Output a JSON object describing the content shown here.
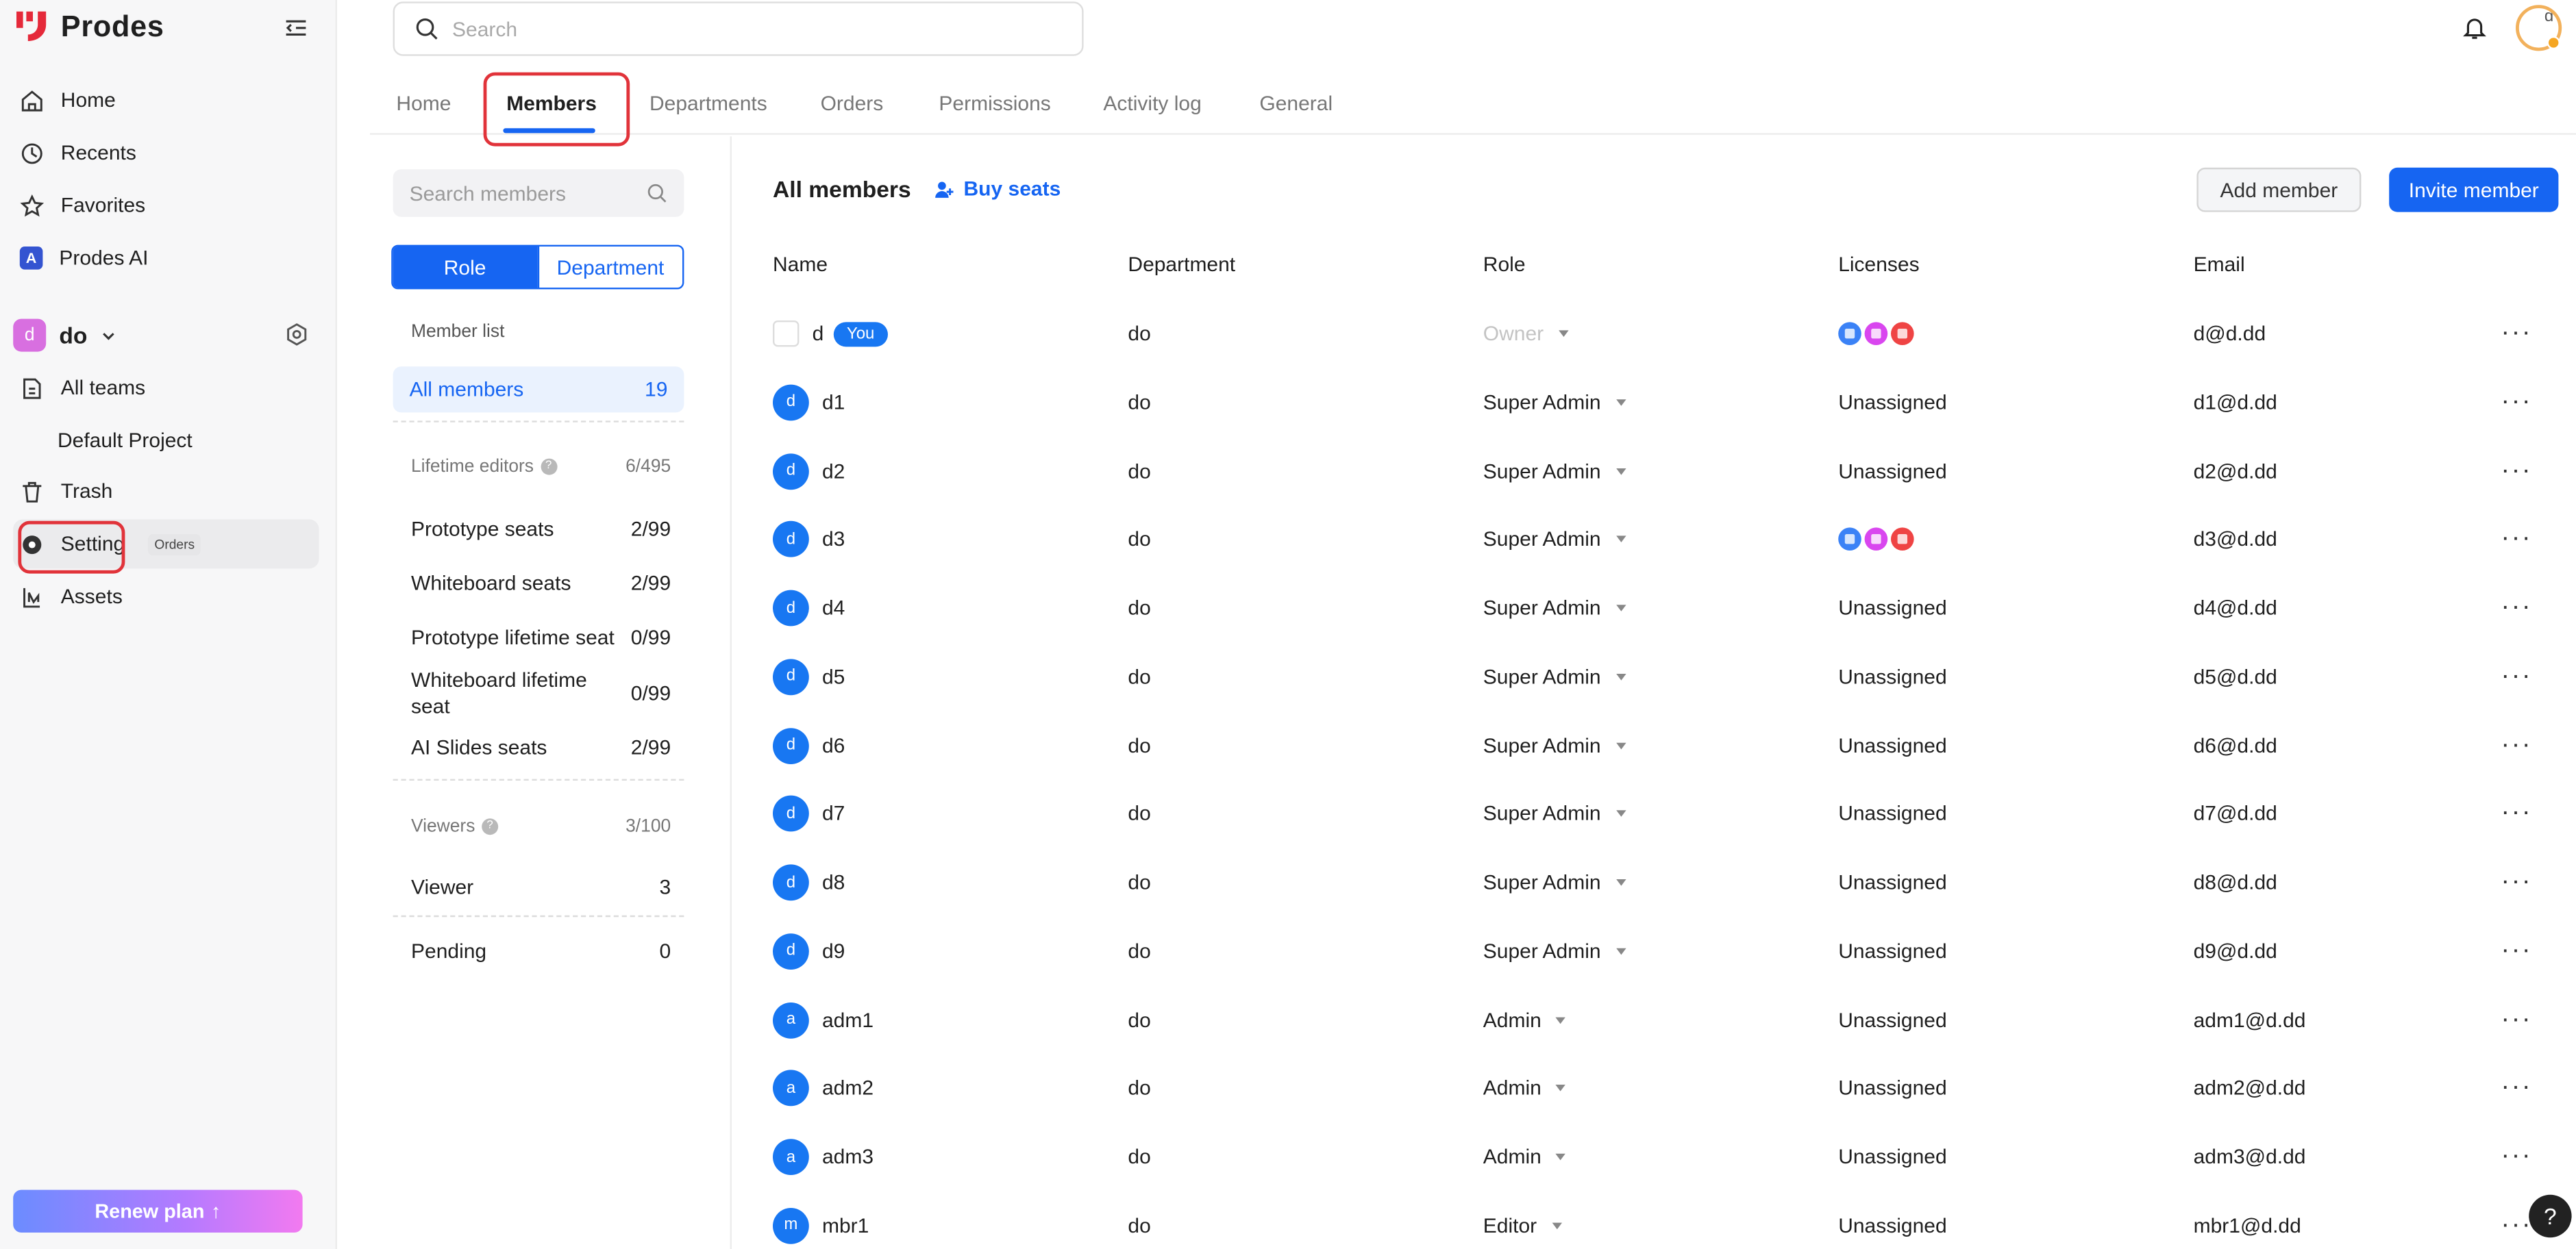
{
  "app": {
    "name": "Prodes"
  },
  "sidebar": {
    "nav": [
      {
        "label": "Home",
        "icon": "home-icon"
      },
      {
        "label": "Recents",
        "icon": "clock-icon"
      },
      {
        "label": "Favorites",
        "icon": "star-icon"
      },
      {
        "label": "Prodes AI",
        "icon": "ai-icon"
      }
    ],
    "team": {
      "avatar": "d",
      "name": "do"
    },
    "team_nav": [
      {
        "label": "All teams"
      },
      {
        "label": "Default Project"
      },
      {
        "label": "Trash"
      },
      {
        "label": "Setting",
        "chip": "Orders"
      },
      {
        "label": "Assets"
      }
    ],
    "renew": "Renew plan"
  },
  "header": {
    "search_placeholder": "Search",
    "user_initial": "d"
  },
  "tabs": [
    "Home",
    "Members",
    "Departments",
    "Orders",
    "Permissions",
    "Activity log",
    "General"
  ],
  "panel": {
    "search_placeholder": "Search members",
    "seg": [
      "Role",
      "Department"
    ],
    "member_list_label": "Member list",
    "all_members": {
      "label": "All members",
      "count": "19"
    },
    "lifetime": {
      "label": "Lifetime editors",
      "count": "6/495"
    },
    "seats": [
      {
        "name": "Prototype seats",
        "count": "2/99"
      },
      {
        "name": "Whiteboard seats",
        "count": "2/99"
      },
      {
        "name": "Prototype lifetime seat",
        "count": "0/99"
      },
      {
        "name": "Whiteboard lifetime seat",
        "count": "0/99"
      },
      {
        "name": "AI Slides seats",
        "count": "2/99"
      }
    ],
    "viewers": {
      "label": "Viewers",
      "count": "3/100"
    },
    "viewer_rows": [
      {
        "name": "Viewer",
        "count": "3"
      },
      {
        "name": "Pending",
        "count": "0"
      }
    ]
  },
  "main": {
    "title": "All members",
    "buy_seats": "Buy seats",
    "add_member": "Add member",
    "invite_member": "Invite member",
    "columns": [
      "Name",
      "Department",
      "Role",
      "Licenses",
      "Email"
    ],
    "rows": [
      {
        "avatar": "",
        "name": "d",
        "you": "You",
        "dept": "do",
        "role": "Owner",
        "licenses": "icons",
        "email": "d@d.dd"
      },
      {
        "avatar": "d",
        "name": "d1",
        "dept": "do",
        "role": "Super Admin",
        "licenses": "Unassigned",
        "email": "d1@d.dd"
      },
      {
        "avatar": "d",
        "name": "d2",
        "dept": "do",
        "role": "Super Admin",
        "licenses": "Unassigned",
        "email": "d2@d.dd"
      },
      {
        "avatar": "d",
        "name": "d3",
        "dept": "do",
        "role": "Super Admin",
        "licenses": "icons",
        "email": "d3@d.dd"
      },
      {
        "avatar": "d",
        "name": "d4",
        "dept": "do",
        "role": "Super Admin",
        "licenses": "Unassigned",
        "email": "d4@d.dd"
      },
      {
        "avatar": "d",
        "name": "d5",
        "dept": "do",
        "role": "Super Admin",
        "licenses": "Unassigned",
        "email": "d5@d.dd"
      },
      {
        "avatar": "d",
        "name": "d6",
        "dept": "do",
        "role": "Super Admin",
        "licenses": "Unassigned",
        "email": "d6@d.dd"
      },
      {
        "avatar": "d",
        "name": "d7",
        "dept": "do",
        "role": "Super Admin",
        "licenses": "Unassigned",
        "email": "d7@d.dd"
      },
      {
        "avatar": "d",
        "name": "d8",
        "dept": "do",
        "role": "Super Admin",
        "licenses": "Unassigned",
        "email": "d8@d.dd"
      },
      {
        "avatar": "d",
        "name": "d9",
        "dept": "do",
        "role": "Super Admin",
        "licenses": "Unassigned",
        "email": "d9@d.dd"
      },
      {
        "avatar": "a",
        "name": "adm1",
        "dept": "do",
        "role": "Admin",
        "licenses": "Unassigned",
        "email": "adm1@d.dd"
      },
      {
        "avatar": "a",
        "name": "adm2",
        "dept": "do",
        "role": "Admin",
        "licenses": "Unassigned",
        "email": "adm2@d.dd"
      },
      {
        "avatar": "a",
        "name": "adm3",
        "dept": "do",
        "role": "Admin",
        "licenses": "Unassigned",
        "email": "adm3@d.dd"
      },
      {
        "avatar": "m",
        "name": "mbr1",
        "dept": "do",
        "role": "Editor",
        "licenses": "Unassigned",
        "email": "mbr1@d.dd"
      }
    ],
    "license_colors": [
      "#3b82f6",
      "#d946ef",
      "#ef4444"
    ]
  },
  "help": "?"
}
